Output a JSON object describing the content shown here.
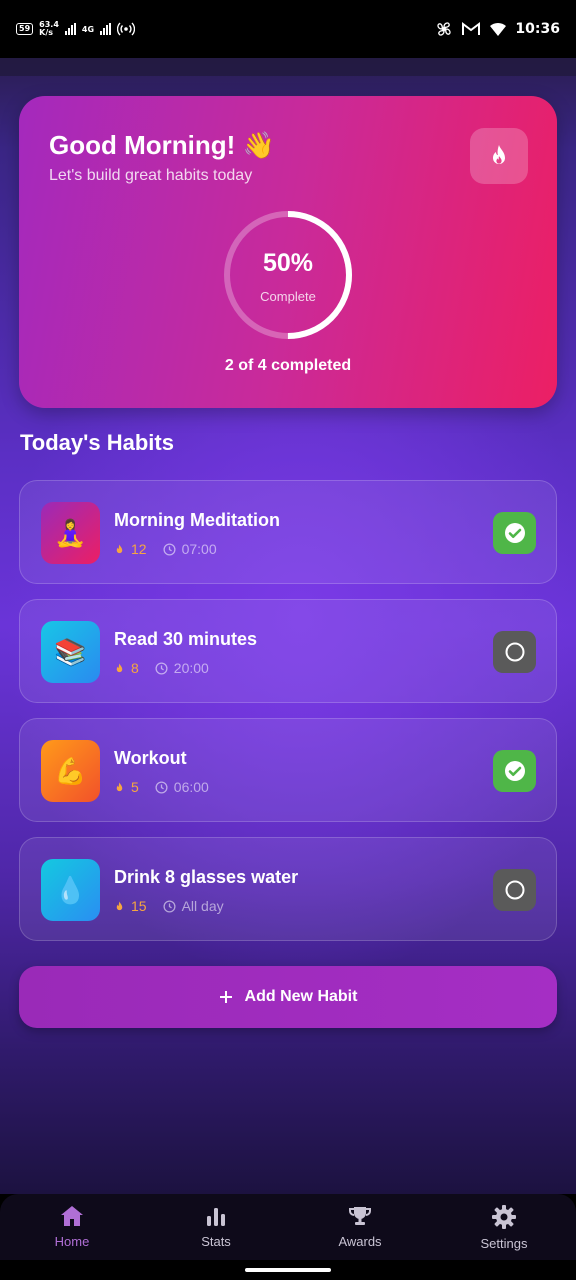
{
  "status_bar": {
    "badge": "59",
    "speed_top": "63.4",
    "speed_bottom": "K/s",
    "network": "4G",
    "time": "10:36"
  },
  "hero": {
    "greeting": "Good Morning! 👋",
    "subtitle": "Let's build great habits today",
    "progress_percent": "50%",
    "progress_fraction": 0.5,
    "progress_label": "Complete",
    "completed_text": "2 of 4 completed"
  },
  "section_title": "Today's Habits",
  "habits": [
    {
      "name": "Morning Meditation",
      "emoji": "🧘‍♀️",
      "streak": "12",
      "time": "07:00",
      "done": true,
      "icon_gradient": [
        "#9b2ab8",
        "#ec1f64"
      ]
    },
    {
      "name": "Read 30 minutes",
      "emoji": "📚",
      "streak": "8",
      "time": "20:00",
      "done": false,
      "icon_gradient": [
        "#18c6e6",
        "#2a8af0"
      ]
    },
    {
      "name": "Workout",
      "emoji": "💪",
      "streak": "5",
      "time": "06:00",
      "done": true,
      "icon_gradient": [
        "#ff9a1a",
        "#f2512a"
      ]
    },
    {
      "name": "Drink 8 glasses water",
      "emoji": "💧",
      "streak": "15",
      "time": "All day",
      "done": false,
      "icon_gradient": [
        "#14c9e0",
        "#2a8ef2"
      ]
    }
  ],
  "add_button_label": "Add New Habit",
  "nav": [
    {
      "label": "Home",
      "icon": "home-icon",
      "active": true
    },
    {
      "label": "Stats",
      "icon": "stats-icon",
      "active": false
    },
    {
      "label": "Awards",
      "icon": "trophy-icon",
      "active": false
    },
    {
      "label": "Settings",
      "icon": "gear-icon",
      "active": false
    }
  ],
  "colors": {
    "accent": "#b06fd6",
    "done_green": "#4fb648",
    "todo_gray": "#5a5a5a",
    "streak_orange": "#f6a640"
  }
}
